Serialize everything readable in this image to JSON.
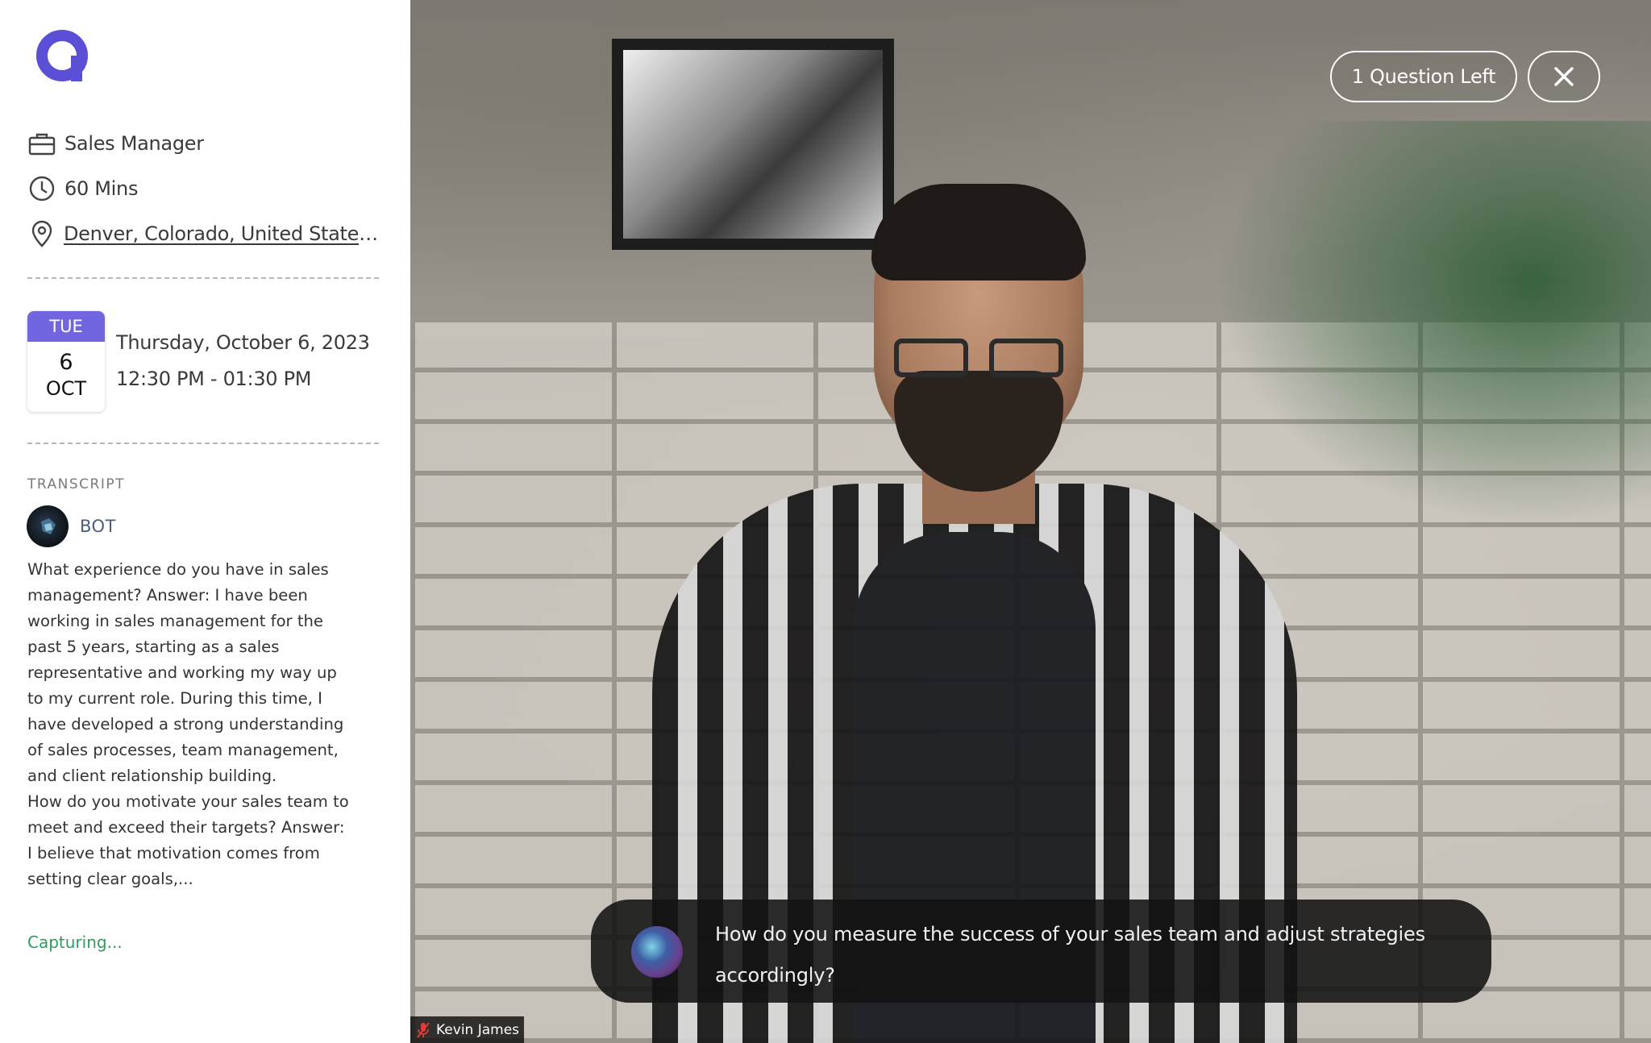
{
  "job": {
    "title": "Sales Manager",
    "duration": "60 Mins",
    "location": "Denver, Colorado, United States of..."
  },
  "schedule": {
    "day_short": "TUE",
    "day_number": "6",
    "month_short": "OCT",
    "date_full": "Thursday, October 6, 2023",
    "time_range": "12:30 PM - 01:30 PM"
  },
  "transcript": {
    "heading": "TRANSCRIPT",
    "speaker": "BOT",
    "text": "What experience do you have in sales management? Answer: I have been working in sales management for the past 5 years, starting as a sales representative and working my way up to my current role. During this time, I have developed a strong understanding of sales processes, team management, and client relationship building.\nHow do you motivate your sales team to meet and exceed their targets? Answer: I believe that motivation comes from setting clear goals,...",
    "status": "Capturing..."
  },
  "video": {
    "questions_left": "1 Question Left",
    "current_question": "How do you measure the success of your sales team and adjust strategies accordingly?",
    "participant_name": "Kevin James"
  },
  "colors": {
    "accent": "#7166e0",
    "logo": "#5b4fd6",
    "capturing": "#2f9d5e"
  },
  "icons": {
    "logo": "brand-logo",
    "job": "briefcase-icon",
    "duration": "clock-icon",
    "location": "map-pin-icon",
    "close": "close-icon",
    "mic": "mic-muted-icon"
  }
}
